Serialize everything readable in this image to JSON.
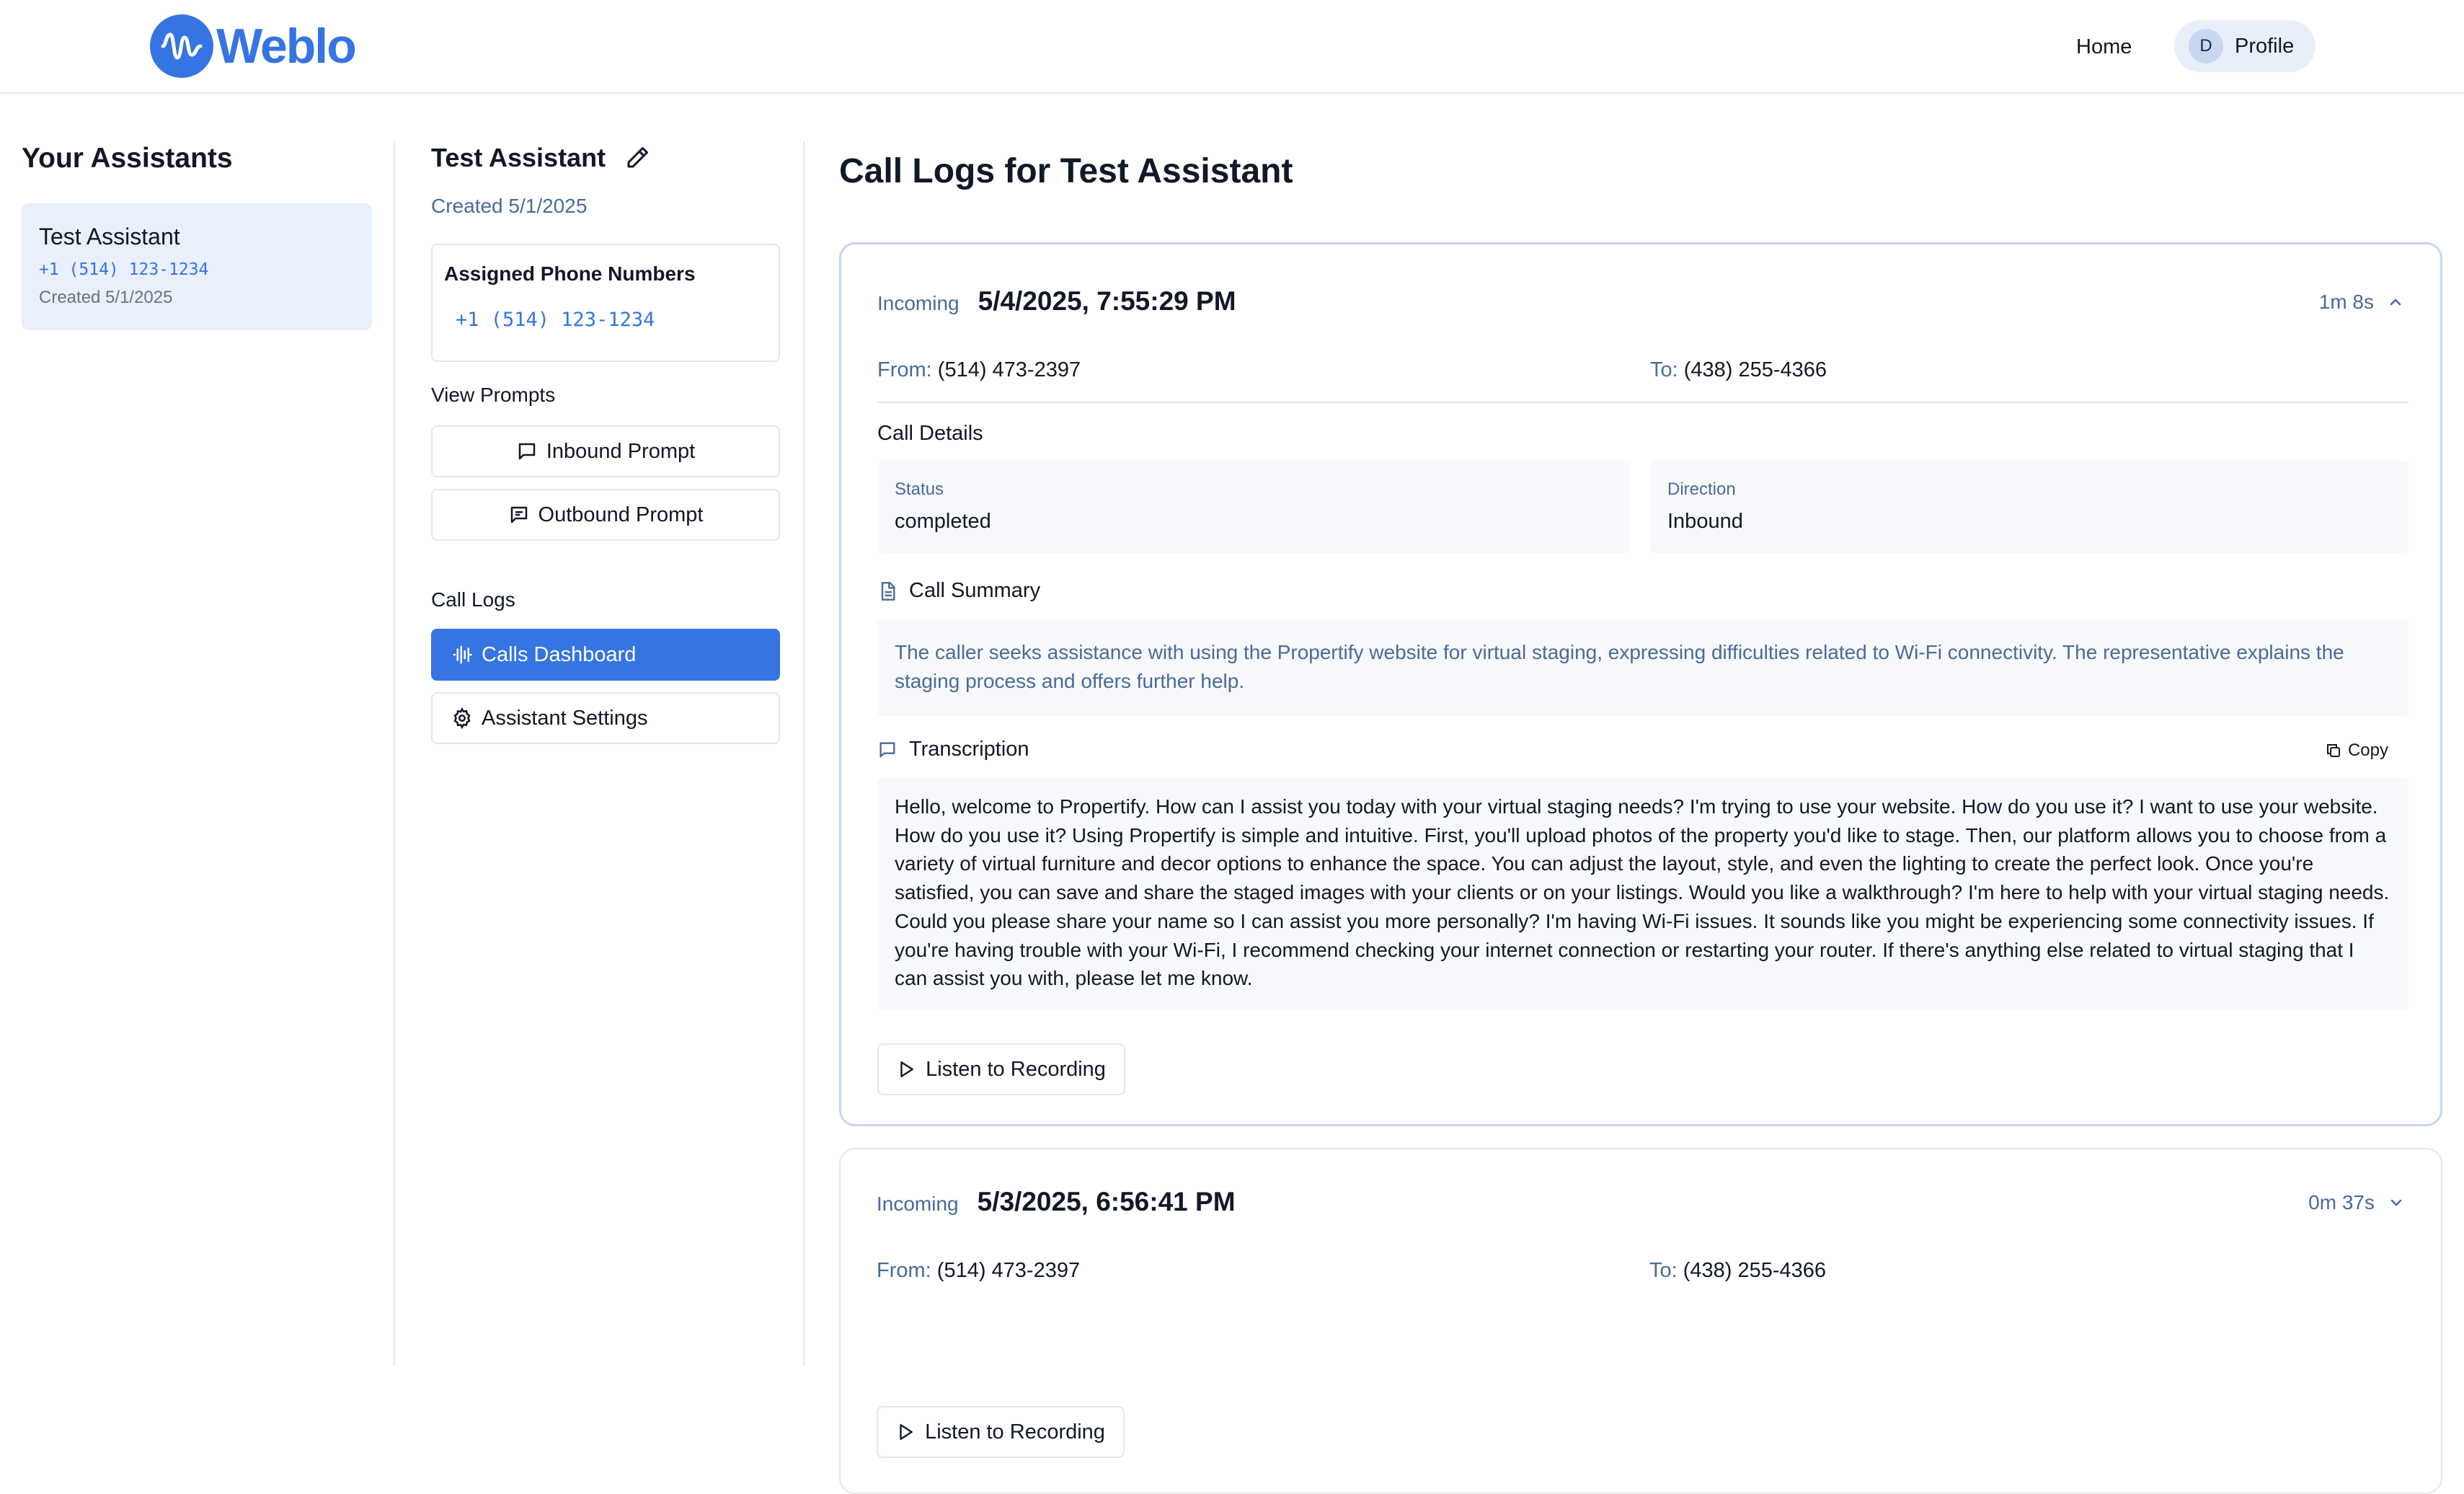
{
  "brand": {
    "name": "Weblo",
    "accent": "#3574e3"
  },
  "nav": {
    "home": "Home",
    "avatar_initial": "D",
    "profile": "Profile"
  },
  "sidebar": {
    "title": "Your Assistants",
    "assistants": [
      {
        "name": "Test Assistant",
        "phone": "+1 (514) 123-1234",
        "created": "Created 5/1/2025"
      }
    ]
  },
  "assistant": {
    "title": "Test Assistant",
    "created": "Created 5/1/2025",
    "phones_label": "Assigned Phone Numbers",
    "phone": "+1 (514) 123-1234",
    "prompts_label": "View Prompts",
    "inbound_prompt": "Inbound Prompt",
    "outbound_prompt": "Outbound Prompt",
    "call_logs_label": "Call Logs",
    "calls_dashboard": "Calls Dashboard",
    "assistant_settings": "Assistant Settings"
  },
  "logs": {
    "title": "Call Logs for Test Assistant",
    "items": [
      {
        "direction_label": "Incoming",
        "datetime": "5/4/2025, 7:55:29 PM",
        "duration": "1m 8s",
        "from_label": "From:",
        "from": "(514) 473-2397",
        "to_label": "To:",
        "to": "(438) 255-4366",
        "details_title": "Call Details",
        "status_label": "Status",
        "status": "completed",
        "direction_field_label": "Direction",
        "direction": "Inbound",
        "summary_title": "Call Summary",
        "summary": "The caller seeks assistance with using the Propertify website for virtual staging, expressing difficulties related to Wi-Fi connectivity. The representative explains the staging process and offers further help.",
        "transcription_title": "Transcription",
        "copy": "Copy",
        "transcription": "Hello, welcome to Propertify. How can I assist you today with your virtual staging needs? I'm trying to use your website. How do you use it? I want to use your website. How do you use it? Using Propertify is simple and intuitive. First, you'll upload photos of the property you'd like to stage. Then, our platform allows you to choose from a variety of virtual furniture and decor options to enhance the space. You can adjust the layout, style, and even the lighting to create the perfect look. Once you're satisfied, you can save and share the staged images with your clients or on your listings. Would you like a walkthrough? I'm here to help with your virtual staging needs. Could you please share your name so I can assist you more personally? I'm having Wi-Fi issues. It sounds like you might be experiencing some connectivity issues. If you're having trouble with your Wi-Fi, I recommend checking your internet connection or restarting your router. If there's anything else related to virtual staging that I can assist you with, please let me know.",
        "listen": "Listen to Recording"
      },
      {
        "direction_label": "Incoming",
        "datetime": "5/3/2025, 6:56:41 PM",
        "duration": "0m 37s",
        "from_label": "From:",
        "from": "(514) 473-2397",
        "to_label": "To:",
        "to": "(438) 255-4366",
        "listen": "Listen to Recording"
      }
    ]
  }
}
